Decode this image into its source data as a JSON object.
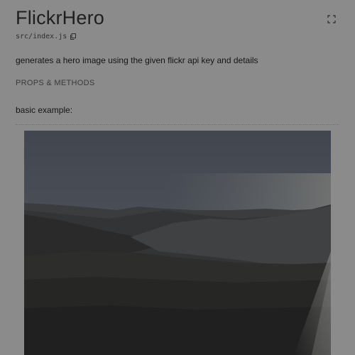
{
  "header": {
    "title": "FlickrHero",
    "path": "src/index.js",
    "expand_icon": "expand-icon",
    "copy_icon": "copy-icon"
  },
  "content": {
    "description": "generates a hero image using the given flickr api key and details",
    "props_link": "PROPS & METHODS",
    "example_label": "basic example:"
  },
  "colors": {
    "overlay_bg": "#8b8b8b",
    "sky": "#4a5059",
    "hills": "#2a2a2a"
  }
}
